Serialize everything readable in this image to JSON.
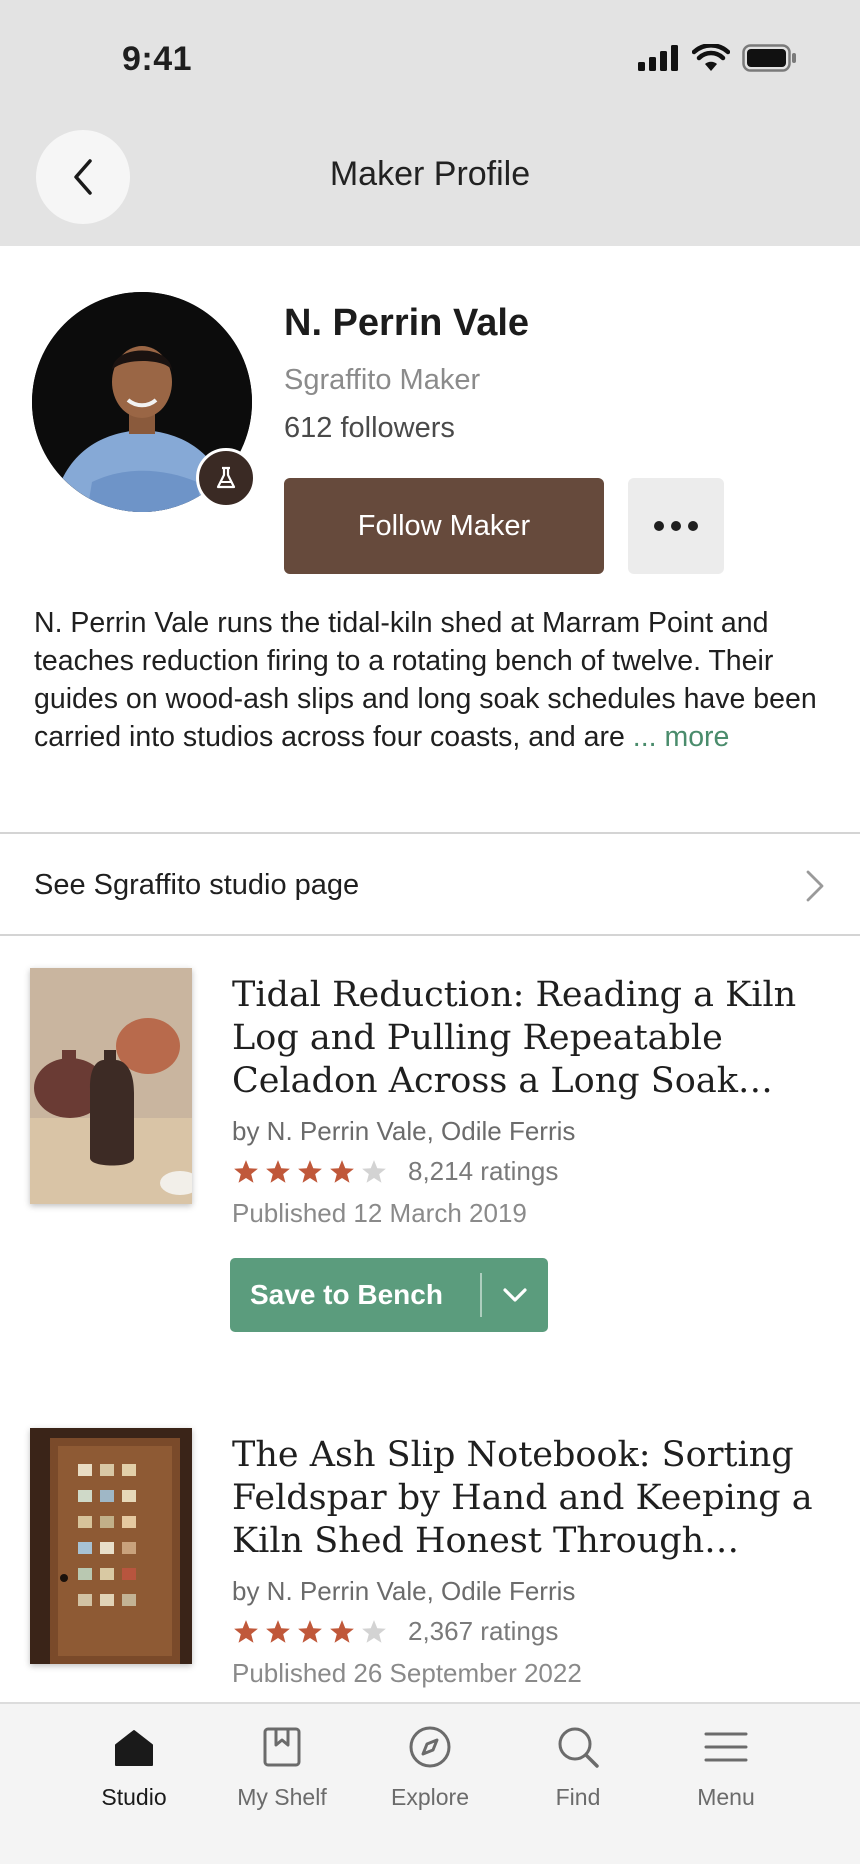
{
  "status_bar": {
    "time": "9:41"
  },
  "header": {
    "title": "Maker Profile"
  },
  "profile": {
    "name": "N. Perrin Vale",
    "role": "Sgraffito Maker",
    "followers": "612 followers",
    "follow_label": "Follow Maker",
    "bio": "N. Perrin Vale runs the tidal-kiln shed at Marram Point and teaches reduction firing to a rotating bench of twelve. Their guides on wood-ash slips and long soak schedules have been carried into studios across four coasts, and are",
    "bio_more": "... more"
  },
  "studio_link": {
    "label": "See Sgraffito studio page"
  },
  "books": [
    {
      "title": "Tidal Reduction: Reading a Kiln Log and Pulling Repeatable Celadon Across a Long Soak…",
      "authors": "by N. Perrin Vale, Odile Ferris",
      "rating": 4,
      "ratings_count": "8,214 ratings",
      "published": "Published 12 March 2019",
      "save_label": "Save to Bench"
    },
    {
      "title": "The Ash Slip Notebook: Sorting Feldspar by Hand and Keeping a Kiln Shed Honest Through…",
      "authors": "by N. Perrin Vale, Odile Ferris",
      "rating": 4,
      "ratings_count": "2,367 ratings",
      "published": "Published 26 September 2022"
    }
  ],
  "tabs": [
    {
      "label": "Studio",
      "icon": "home-icon",
      "active": true
    },
    {
      "label": "My Shelf",
      "icon": "bookmark-book-icon",
      "active": false
    },
    {
      "label": "Explore",
      "icon": "compass-icon",
      "active": false
    },
    {
      "label": "Find",
      "icon": "search-icon",
      "active": false
    },
    {
      "label": "Menu",
      "icon": "menu-icon",
      "active": false
    }
  ],
  "colors": {
    "header_bg": "#e3e3e3",
    "follow_button": "#664a3c",
    "save_button": "#5b9c7d",
    "star_filled": "#c0583a",
    "star_empty": "#d3d3d3",
    "link_green": "#4a8c6c"
  }
}
